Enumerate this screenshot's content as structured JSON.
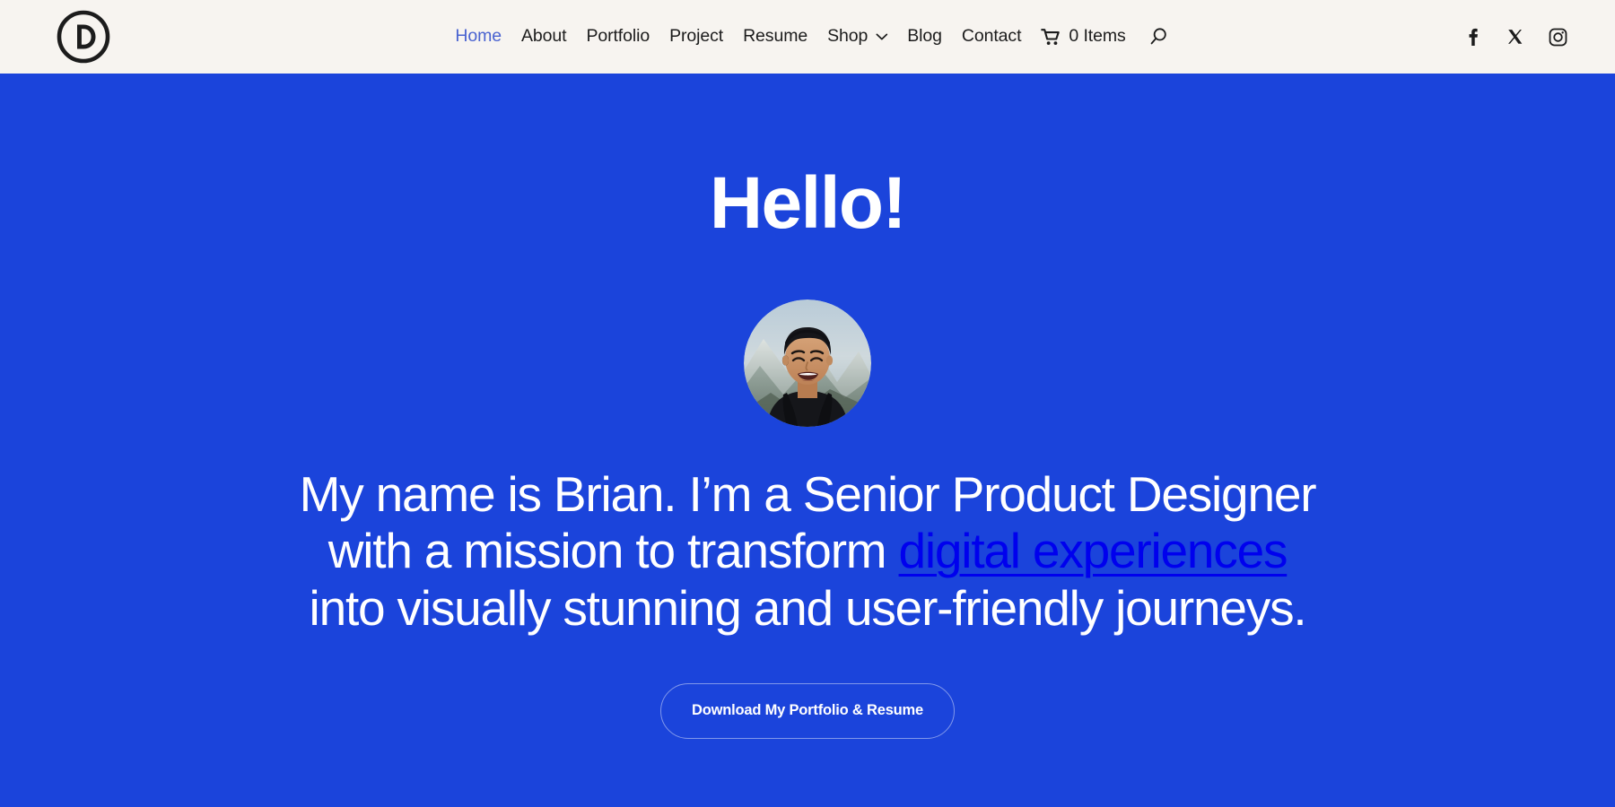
{
  "theme": {
    "hero_background": "#1B44DB",
    "header_background": "#F7F4F0",
    "active_nav_color": "#4A63D0",
    "nav_text_color": "#1C1C1C",
    "hero_text_color": "#FFFFFF"
  },
  "header": {
    "logo": {
      "name": "divi-circle-d-logo",
      "letter": "D"
    },
    "nav_items": [
      {
        "label": "Home",
        "active": true,
        "has_dropdown": false
      },
      {
        "label": "About",
        "active": false,
        "has_dropdown": false
      },
      {
        "label": "Portfolio",
        "active": false,
        "has_dropdown": false
      },
      {
        "label": "Project",
        "active": false,
        "has_dropdown": false
      },
      {
        "label": "Resume",
        "active": false,
        "has_dropdown": false
      },
      {
        "label": "Shop",
        "active": false,
        "has_dropdown": true
      },
      {
        "label": "Blog",
        "active": false,
        "has_dropdown": false
      },
      {
        "label": "Contact",
        "active": false,
        "has_dropdown": false
      }
    ],
    "cart": {
      "icon": "shopping-cart-icon",
      "label": "0 Items"
    },
    "search": {
      "icon": "search-icon"
    },
    "social": [
      {
        "name": "facebook",
        "icon": "facebook-icon"
      },
      {
        "name": "x-twitter",
        "icon": "x-twitter-icon"
      },
      {
        "name": "instagram",
        "icon": "instagram-icon"
      }
    ]
  },
  "hero": {
    "heading": "Hello!",
    "avatar": {
      "alt": "Portrait photo of Brian smiling in front of mountains"
    },
    "intro": {
      "part1": "My name is Brian. I’m a Senior Product Designer with a mission to transform ",
      "emphasis": "digital experiences",
      "part2": " into visually stunning and user-friendly journeys."
    },
    "cta": {
      "label": "Download My Portfolio & Resume"
    }
  }
}
